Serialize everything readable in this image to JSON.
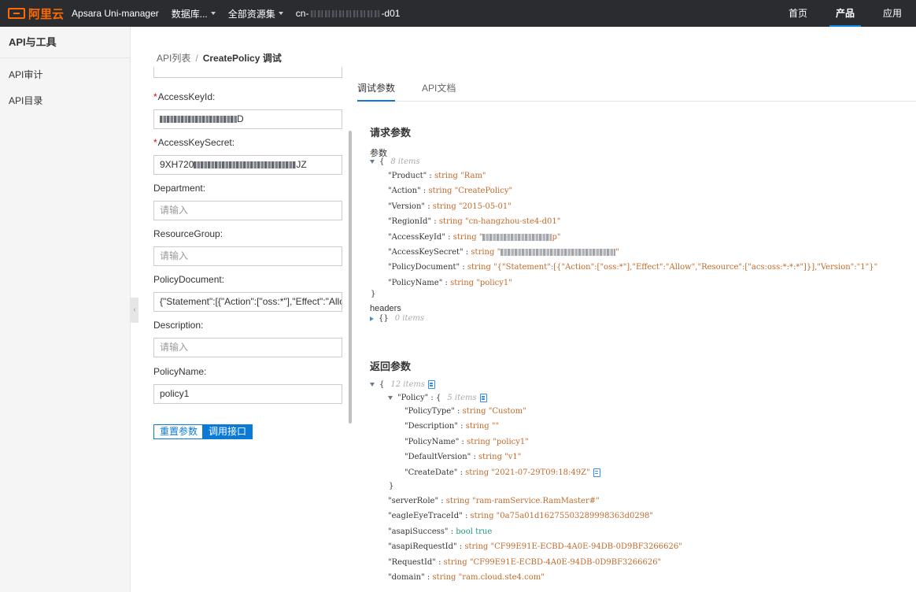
{
  "topbar": {
    "logo_text": "阿里云",
    "product": "Apsara Uni-manager",
    "menu1": "数据库...",
    "menu2": "全部资源集",
    "region_prefix": "cn-",
    "region_suffix": "-d01",
    "links": [
      "首页",
      "产品",
      "应用"
    ],
    "active_link": "产品",
    "accent_color": "#ff6a00"
  },
  "sidebar": {
    "title": "API与工具",
    "items": [
      "API审计",
      "API目录"
    ]
  },
  "breadcrumb": {
    "root": "API列表",
    "separator": "/",
    "current": "CreatePolicy 调试"
  },
  "form": {
    "fields": [
      {
        "label": "AccessKeyId:",
        "required": true,
        "prefix": "",
        "suffix": "D",
        "masked": true
      },
      {
        "label": "AccessKeySecret:",
        "required": true,
        "prefix": "9XH720",
        "suffix": "JZ",
        "masked": true
      },
      {
        "label": "Department:",
        "required": false,
        "placeholder": "请输入"
      },
      {
        "label": "ResourceGroup:",
        "required": false,
        "placeholder": "请输入"
      },
      {
        "label": "PolicyDocument:",
        "required": false,
        "value": "{\"Statement\":[{\"Action\":[\"oss:*\"],\"Effect\":\"Allow\",\"Res"
      },
      {
        "label": "Description:",
        "required": false,
        "placeholder": "请输入"
      },
      {
        "label": "PolicyName:",
        "required": false,
        "value": "policy1"
      }
    ],
    "reset_label": "重置参数",
    "call_label": "调用接口"
  },
  "tabs": {
    "debug": "调试参数",
    "docs": "API文档"
  },
  "request": {
    "title": "请求参数",
    "params_label": "参数",
    "count": "8 items",
    "lines": [
      {
        "key": "\"Product\"",
        "type": "string",
        "val": "\"Ram\""
      },
      {
        "key": "\"Action\"",
        "type": "string",
        "val": "\"CreatePolicy\""
      },
      {
        "key": "\"Version\"",
        "type": "string",
        "val": "\"2015-05-01\""
      },
      {
        "key": "\"RegionId\"",
        "type": "string",
        "val": "\"cn-hangzhou-ste4-d01\""
      },
      {
        "key": "\"AccessKeyId\"",
        "type": "string",
        "val": "\"",
        "val_end": "p\""
      },
      {
        "key": "\"AccessKeySecret\"",
        "type": "string",
        "val": "\"",
        "val_end": "\""
      },
      {
        "key": "\"PolicyDocument\"",
        "type": "string",
        "val": "\"{\"Statement\":[{\"Action\":[\"oss:*\"],\"Effect\":\"Allow\",\"Resource\":[\"acs:oss:*:*:*\"]}],\"Version\":\"1\"}\""
      },
      {
        "key": "\"PolicyName\"",
        "type": "string",
        "val": "\"policy1\""
      }
    ],
    "headers_label": "headers",
    "headers_count": "0 items",
    "open_brace": "{",
    "close_brace": "}",
    "empty_obj": "{}"
  },
  "response": {
    "title": "返回参数",
    "count": "12 items",
    "policy_key": "\"Policy\"",
    "policy_count": "5 items",
    "policy_lines": [
      {
        "key": "\"PolicyType\"",
        "type": "string",
        "val": "\"Custom\""
      },
      {
        "key": "\"Description\"",
        "type": "string",
        "val": "\"\""
      },
      {
        "key": "\"PolicyName\"",
        "type": "string",
        "val": "\"policy1\""
      },
      {
        "key": "\"DefaultVersion\"",
        "type": "string",
        "val": "\"v1\""
      },
      {
        "key": "\"CreateDate\"",
        "type": "string",
        "val": "\"2021-07-29T09:18:49Z\""
      }
    ],
    "lines": [
      {
        "key": "\"serverRole\"",
        "type": "string",
        "val": "\"ram-ramService.RamMaster#\""
      },
      {
        "key": "\"eagleEyeTraceId\"",
        "type": "string",
        "val": "\"0a75a01d16275503289998363d0298\""
      },
      {
        "key": "\"asapiSuccess\"",
        "type": "bool",
        "val": "true"
      },
      {
        "key": "\"asapiRequestId\"",
        "type": "string",
        "val": "\"CF99E91E-ECBD-4A0E-94DB-0D9BF3266626\""
      },
      {
        "key": "\"RequestId\"",
        "type": "string",
        "val": "\"CF99E91E-ECBD-4A0E-94DB-0D9BF3266626\""
      },
      {
        "key": "\"domain\"",
        "type": "string",
        "val": "\"ram.cloud.ste4.com\""
      }
    ],
    "colon": ":"
  }
}
